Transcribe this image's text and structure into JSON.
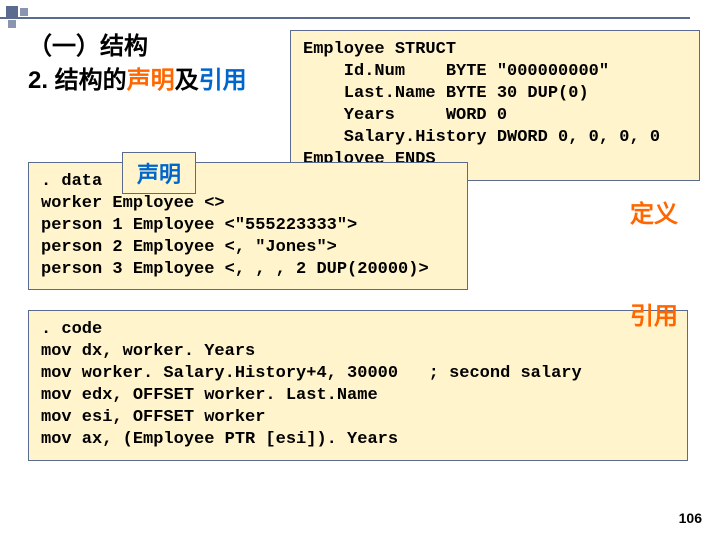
{
  "heading": {
    "part1": "（一）结构",
    "part2_prefix": "2. 结构的",
    "part2_orange": "声明",
    "part2_mid": "及",
    "part2_blue": "引用"
  },
  "struct_code": "Employee STRUCT\n    Id.Num    BYTE \"000000000\"\n    Last.Name BYTE 30 DUP(0)\n    Years     WORD 0\n    Salary.History DWORD 0, 0, 0, 0\nEmployee ENDS",
  "data_code": ". data\nworker Employee <>\nperson 1 Employee <\"555223333\">\nperson 2 Employee <, \"Jones\">\nperson 3 Employee <, , , 2 DUP(20000)>",
  "code_code": ". code\nmov dx, worker. Years\nmov worker. Salary.History+4, 30000   ; second salary\nmov edx, OFFSET worker. Last.Name\nmov esi, OFFSET worker\nmov ax, (Employee PTR [esi]). Years",
  "labels": {
    "declare": "声明",
    "define": "定义",
    "reference": "引用"
  },
  "page_number": "106"
}
